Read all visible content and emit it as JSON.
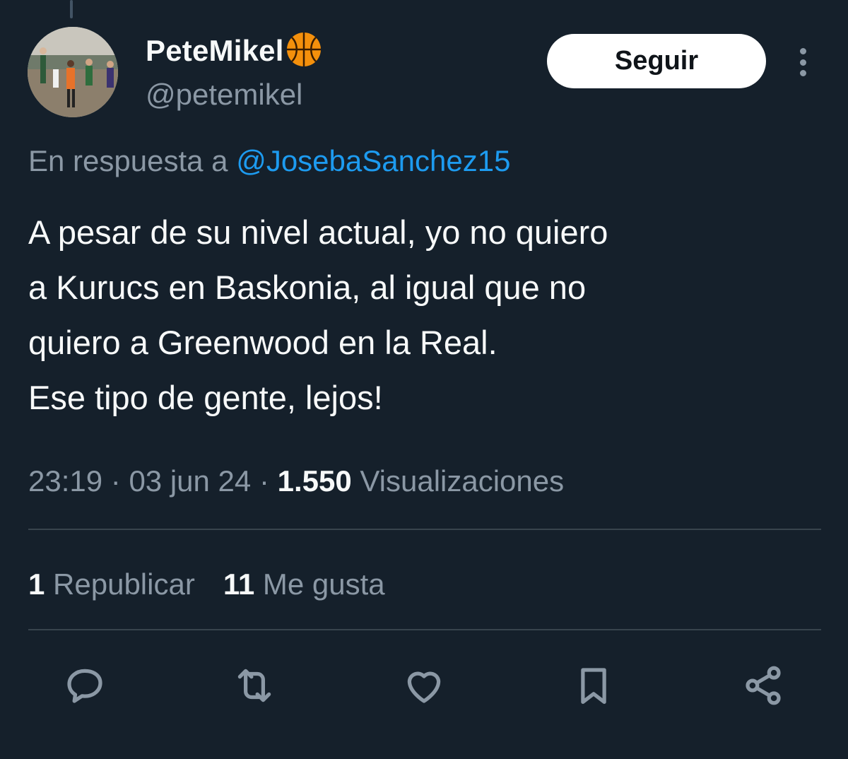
{
  "user": {
    "display_name": "PeteMikel",
    "display_name_emoji": "basketball-emoji",
    "handle": "@petemikel",
    "avatar": "avatar-photo-basketball-game"
  },
  "follow_label": "Seguir",
  "more_icon": "more-vertical-icon",
  "reply": {
    "prefix": "En respuesta a",
    "mention": "@JosebaSanchez15"
  },
  "tweet": {
    "text": "A pesar de su nivel actual, yo no quiero\na Kurucs en Baskonia, al igual que no\nquiero a Greenwood en la Real.\nEse tipo de gente, lejos!"
  },
  "meta": {
    "time": "23:19",
    "date": "03 jun 24",
    "views_count": "1.550",
    "views_label": "Visualizaciones",
    "separator": "·"
  },
  "stats": {
    "reposts_count": "1",
    "reposts_label": "Republicar",
    "likes_count": "11",
    "likes_label": "Me gusta"
  },
  "actions": [
    "reply-icon",
    "repost-icon",
    "like-icon",
    "bookmark-icon",
    "share-icon"
  ],
  "colors": {
    "background": "#15202b",
    "text": "#f7f9f9",
    "secondary": "#8b98a5",
    "link": "#1d9bf0",
    "divider": "#38444d"
  }
}
